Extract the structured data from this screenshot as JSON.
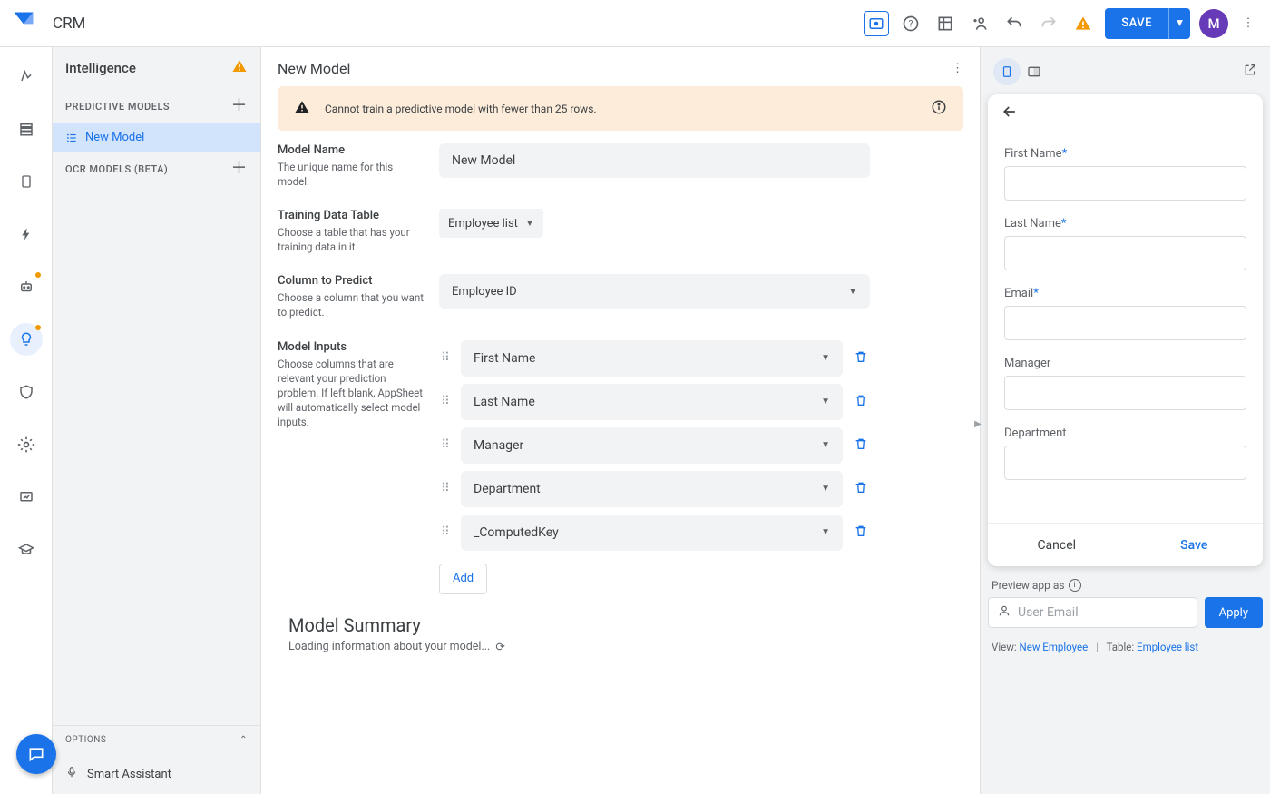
{
  "header": {
    "app_name": "CRM",
    "save_label": "SAVE",
    "avatar_letter": "M"
  },
  "intel": {
    "title": "Intelligence",
    "section_predictive": "PREDICTIVE MODELS",
    "model_item": "New Model",
    "section_ocr": "OCR MODELS (BETA)",
    "options_label": "OPTIONS",
    "assistant_label": "Smart Assistant"
  },
  "main": {
    "title": "New Model",
    "alert_text": "Cannot train a predictive model with fewer than 25 rows.",
    "model_name": {
      "label": "Model Name",
      "desc": "The unique name for this model.",
      "value": "New Model"
    },
    "training": {
      "label": "Training Data Table",
      "desc": "Choose a table that has your training data in it.",
      "value": "Employee list"
    },
    "predict": {
      "label": "Column to Predict",
      "desc": "Choose a column that you want to predict.",
      "value": "Employee ID"
    },
    "inputs": {
      "label": "Model Inputs",
      "desc": "Choose columns that are relevant your prediction problem. If left blank, AppSheet will automatically select model inputs.",
      "items": [
        "First Name",
        "Last Name",
        "Manager",
        "Department",
        "_ComputedKey"
      ],
      "add_label": "Add"
    },
    "summary": {
      "title": "Model Summary",
      "loading": "Loading information about your model..."
    }
  },
  "preview": {
    "fields": [
      {
        "label": "First Name",
        "required": true
      },
      {
        "label": "Last Name",
        "required": true
      },
      {
        "label": "Email",
        "required": true
      },
      {
        "label": "Manager",
        "required": false
      },
      {
        "label": "Department",
        "required": false
      }
    ],
    "cancel_label": "Cancel",
    "save_label": "Save",
    "preview_as_label": "Preview app as",
    "email_placeholder": "User Email",
    "apply_label": "Apply",
    "meta_view_label": "View:",
    "meta_view_value": "New Employee",
    "meta_table_label": "Table:",
    "meta_table_value": "Employee list"
  }
}
